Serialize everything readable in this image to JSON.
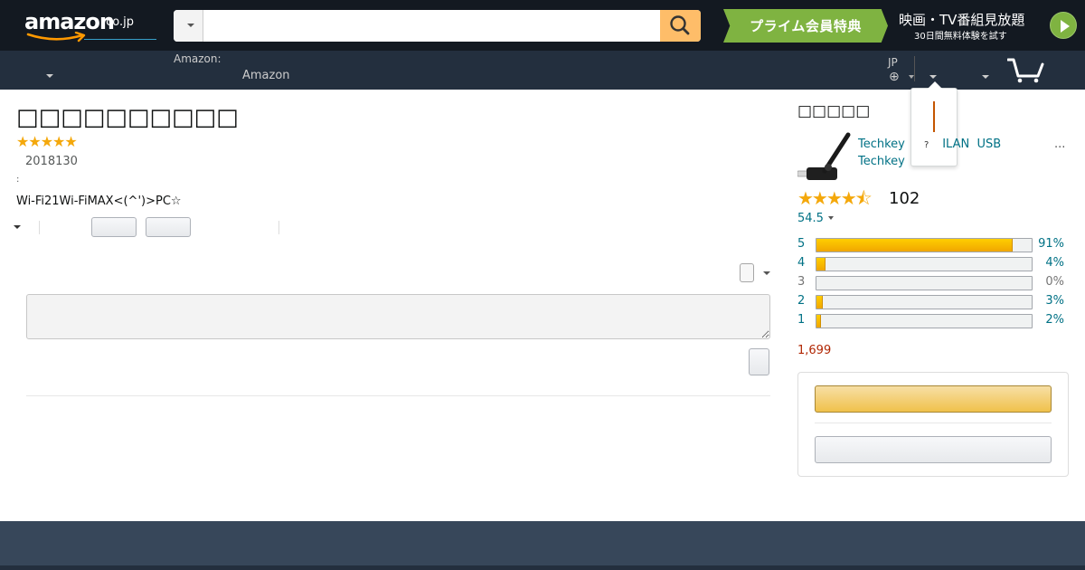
{
  "header": {
    "logo_text": "amazon",
    "logo_tld": ".co.jp",
    "search": {
      "value": "",
      "placeholder": ""
    },
    "prime_banner": "プライム会員特典",
    "prime_title": "映画・TV番組見放題",
    "prime_sub": "30日間無料体験を試す",
    "sub_label": "Amazon:",
    "sub_link": "Amazon",
    "language": "JP",
    "globe_icon": "⊕"
  },
  "popover": {
    "mark": "?"
  },
  "review": {
    "title": "□□□□□□□□□□",
    "stars": "★★★★★",
    "date": "2018130",
    "colon": ":",
    "body": "Wi-Fi21Wi-FiMAX<(^')>PC☆"
  },
  "sidebar": {
    "heading": "□□□□□",
    "product_line1": "Techkey          ILAN  USB",
    "product_line2": "Techkey",
    "more": "...",
    "rating_stars": "★★★★⯪",
    "rating_count": "102",
    "rating_avg": "54.5",
    "histogram": [
      {
        "star": "5",
        "pct": "91%",
        "fill": 0.91,
        "link": true
      },
      {
        "star": "4",
        "pct": "4%",
        "fill": 0.04,
        "link": true
      },
      {
        "star": "3",
        "pct": "0%",
        "fill": 0.0,
        "link": false
      },
      {
        "star": "2",
        "pct": "3%",
        "fill": 0.03,
        "link": true
      },
      {
        "star": "1",
        "pct": "2%",
        "fill": 0.02,
        "link": true
      }
    ],
    "price": "1,699"
  },
  "colors": {
    "nav_top": "#131921",
    "nav_bottom": "#232f3e",
    "search_button": "#febd69",
    "prime_green": "#7fb341",
    "star": "#f4a80b",
    "link": "#007185",
    "price": "#b12704",
    "footer": "#37475a"
  }
}
